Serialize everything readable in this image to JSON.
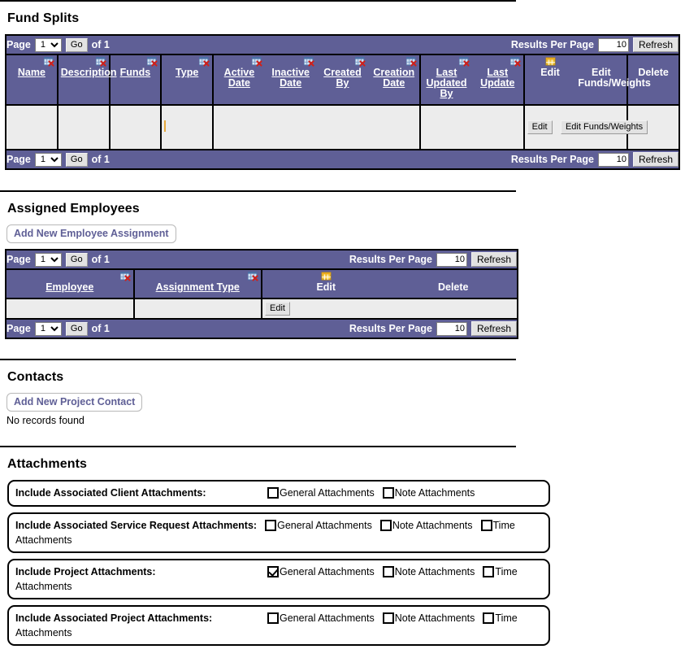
{
  "sections": {
    "fund_splits": {
      "title": "Fund Splits",
      "pagination": {
        "page_label": "Page",
        "page_value": "1",
        "go_label": "Go",
        "of_label": "of 1",
        "results_per_page_label": "Results Per Page",
        "results_per_page_value": "10",
        "refresh_label": "Refresh"
      },
      "columns": [
        {
          "label": "Name",
          "icon": "grid-remove-icon",
          "sortable": true
        },
        {
          "label": "Description",
          "icon": "grid-remove-icon",
          "sortable": true
        },
        {
          "label": "Funds",
          "icon": "grid-remove-icon",
          "sortable": true
        },
        {
          "label": "Type",
          "icon": "grid-remove-icon",
          "sortable": true
        },
        {
          "label": "Active Date",
          "icon": "grid-remove-icon",
          "sortable": true
        },
        {
          "label": "Inactive Date",
          "icon": "grid-remove-icon",
          "sortable": true
        },
        {
          "label": "Created By",
          "icon": "grid-remove-icon",
          "sortable": true
        },
        {
          "label": "Creation Date",
          "icon": "grid-remove-icon",
          "sortable": true
        },
        {
          "label": "Last Updated By",
          "icon": "grid-remove-icon",
          "sortable": true
        },
        {
          "label": "Last Update",
          "icon": "grid-remove-icon",
          "sortable": true
        },
        {
          "label": "Edit",
          "icon": "grid-add-icon",
          "sortable": false
        },
        {
          "label": "Edit Funds/Weights",
          "icon": "",
          "sortable": false
        },
        {
          "label": "Delete",
          "icon": "",
          "sortable": false
        }
      ],
      "row": {
        "name": "",
        "description": "",
        "funds": "",
        "type": "",
        "active_date": "",
        "inactive_date": "",
        "created_by": "",
        "creation_date": "",
        "last_updated_by": "",
        "last_update": "",
        "edit_label": "Edit",
        "edit_funds_weights_label": "Edit Funds/Weights",
        "delete": ""
      }
    },
    "assigned_employees": {
      "title": "Assigned Employees",
      "add_button_label": "Add New Employee Assignment",
      "pagination": {
        "page_label": "Page",
        "page_value": "1",
        "go_label": "Go",
        "of_label": "of 1",
        "results_per_page_label": "Results Per Page",
        "results_per_page_value": "10",
        "refresh_label": "Refresh"
      },
      "columns": [
        {
          "label": "Employee",
          "icon": "grid-remove-icon",
          "sortable": true
        },
        {
          "label": "Assignment Type",
          "icon": "grid-remove-icon",
          "sortable": true
        },
        {
          "label": "Edit",
          "icon": "grid-add-icon",
          "sortable": false
        },
        {
          "label": "Delete",
          "icon": "",
          "sortable": false
        }
      ],
      "row": {
        "employee": "",
        "assignment_type": "",
        "edit_label": "Edit",
        "delete": ""
      }
    },
    "contacts": {
      "title": "Contacts",
      "add_button_label": "Add New Project Contact",
      "empty_message": "No records found"
    },
    "attachments": {
      "title": "Attachments",
      "rows": [
        {
          "label": "Include Associated Client Attachments:",
          "options": [
            {
              "label": "General Attachments",
              "checked": false
            },
            {
              "label": "Note Attachments",
              "checked": false
            }
          ],
          "wrap_text": ""
        },
        {
          "label": "Include Associated Service Request Attachments:",
          "options": [
            {
              "label": "General Attachments",
              "checked": false
            },
            {
              "label": "Note Attachments",
              "checked": false
            },
            {
              "label": "Time",
              "checked": false
            }
          ],
          "wrap_text": "Attachments"
        },
        {
          "label": "Include Project Attachments:",
          "options": [
            {
              "label": "General Attachments",
              "checked": true
            },
            {
              "label": "Note Attachments",
              "checked": false
            },
            {
              "label": "Time",
              "checked": false
            }
          ],
          "wrap_text": "Attachments"
        },
        {
          "label": "Include Associated Project Attachments:",
          "options": [
            {
              "label": "General Attachments",
              "checked": false
            },
            {
              "label": "Note Attachments",
              "checked": false
            },
            {
              "label": "Time",
              "checked": false
            }
          ],
          "wrap_text": "Attachments"
        }
      ]
    }
  },
  "colors": {
    "header_purple": "#5f5f96",
    "row_gray": "#ececec",
    "link_white": "#ffffff",
    "accent_orange": "#f0b429"
  }
}
